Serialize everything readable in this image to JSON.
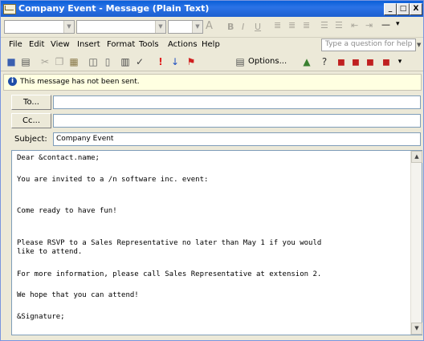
{
  "window": {
    "title": "Company Event - Message (Plain Text)",
    "minimize_label": "_",
    "maximize_label": "□",
    "close_label": "X"
  },
  "format_toolbar": {
    "font_name": "",
    "font_size": "",
    "icons": [
      "font-color-icon",
      "bold-icon",
      "italic-icon",
      "underline-icon",
      "align-left-icon",
      "align-center-icon",
      "align-right-icon",
      "bullets-icon",
      "numbering-icon",
      "decrease-indent-icon",
      "increase-indent-icon",
      "horizontal-line-icon"
    ]
  },
  "menu": {
    "items": [
      "File",
      "Edit",
      "View",
      "Insert",
      "Format",
      "Tools",
      "Actions",
      "Help"
    ],
    "ask_placeholder": "Type a question for help"
  },
  "standard_toolbar": {
    "options_label": "Options...",
    "icons": [
      "save-icon",
      "print-icon",
      "cut-icon",
      "copy-icon",
      "paste-icon",
      "preview-icon",
      "attach-icon",
      "address-book-icon",
      "check-names-icon",
      "importance-high-icon",
      "importance-low-icon",
      "flag-icon",
      "options-icon",
      "design-icon",
      "help-icon",
      "previous-icon",
      "next-icon",
      "move-icon",
      "more-icon"
    ]
  },
  "info_bar": {
    "text": "This message has not been sent."
  },
  "address": {
    "to_label": "To...",
    "to_value": "",
    "cc_label": "Cc...",
    "cc_value": "",
    "subject_label": "Subject:",
    "subject_value": "Company Event"
  },
  "body": {
    "lines": [
      "Dear &contact.name;",
      "You are invited to a /n software inc. event:",
      "Come ready to have fun!",
      "Please RSVP to a Sales Representative no later than May 1 if you would",
      "like to attend.",
      "For more information, please call Sales Representative at extension 2.",
      "We hope that you can attend!",
      "&Signature;"
    ]
  }
}
